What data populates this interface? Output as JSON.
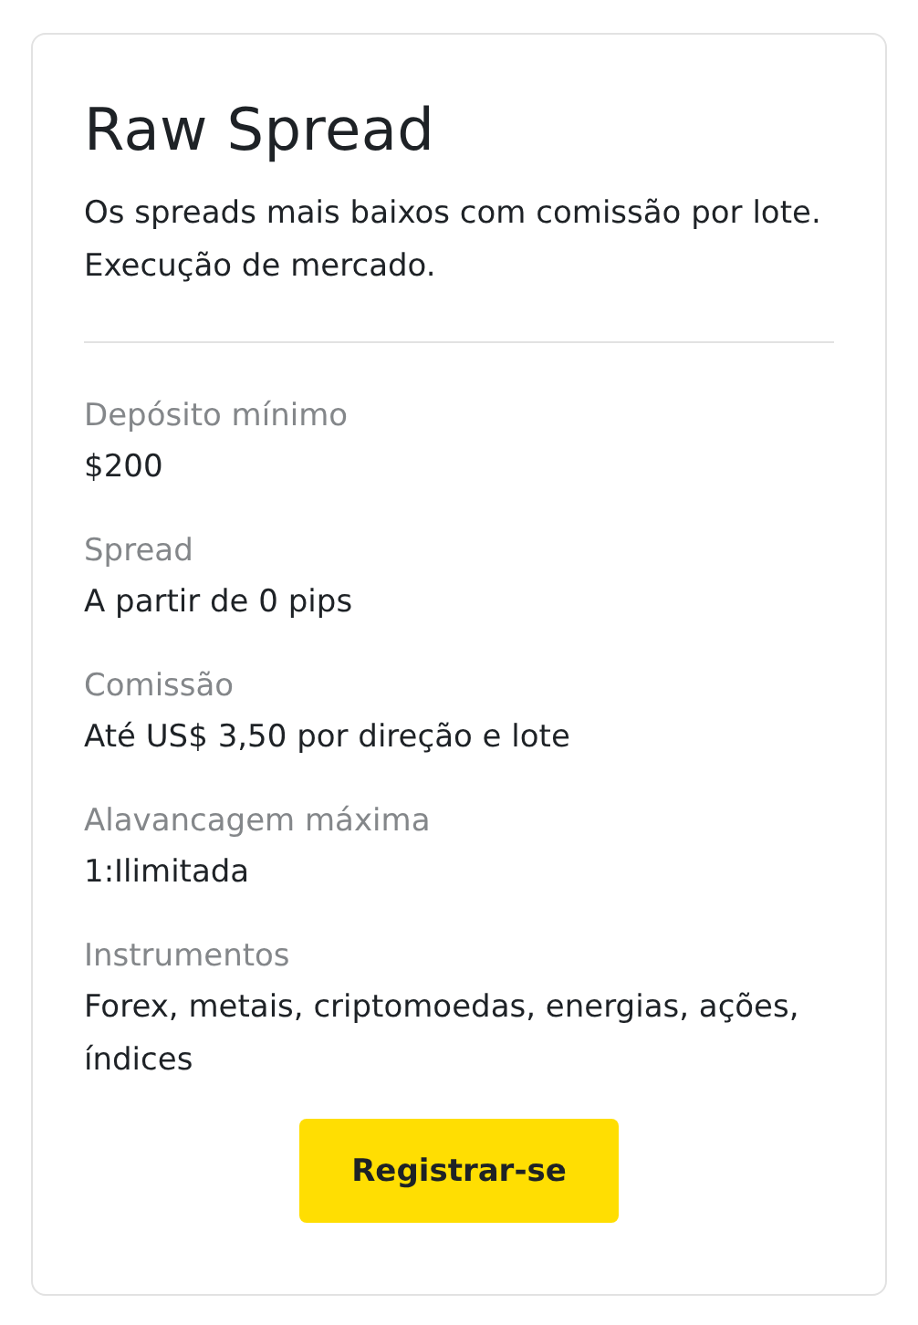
{
  "card": {
    "title": "Raw Spread",
    "description": "Os spreads mais baixos com comissão por lote. Execução de mercado.",
    "specs": [
      {
        "label": "Depósito mínimo",
        "value": "$200"
      },
      {
        "label": "Spread",
        "value": "A partir de 0 pips"
      },
      {
        "label": "Comissão",
        "value": "Até US$ 3,50 por direção e lote"
      },
      {
        "label": "Alavancagem máxima",
        "value": "1:Ilimitada"
      },
      {
        "label": "Instrumentos",
        "value": "Forex, metais, criptomoedas, energias, ações, índices"
      }
    ],
    "button": "Registrar-se"
  }
}
